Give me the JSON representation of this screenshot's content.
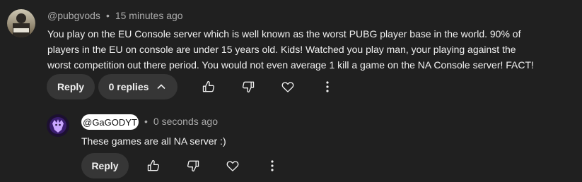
{
  "comment": {
    "author": "@pubgvods",
    "time": "15 minutes ago",
    "text": "You play on the EU Console server which is well known as the worst PUBG player base in the world. 90% of players in the EU on console are under 15 years old. Kids! Watched you play man, your playing against the worst competition out there period. You would not even average 1 kill a game on the NA Console server! FACT!",
    "reply_label": "Reply",
    "replies_label": "0 replies"
  },
  "reply": {
    "author": "@GaGODYT",
    "time": "0 seconds ago",
    "text": "These games are all NA server :)",
    "reply_label": "Reply"
  },
  "meta": {
    "separator": "•"
  },
  "icons": [
    "like-icon",
    "dislike-icon",
    "heart-icon",
    "more-vert-icon",
    "chevron-up-icon"
  ],
  "colors": {
    "background": "#202020",
    "button": "#363636",
    "muted_text": "#aaaaaa"
  }
}
